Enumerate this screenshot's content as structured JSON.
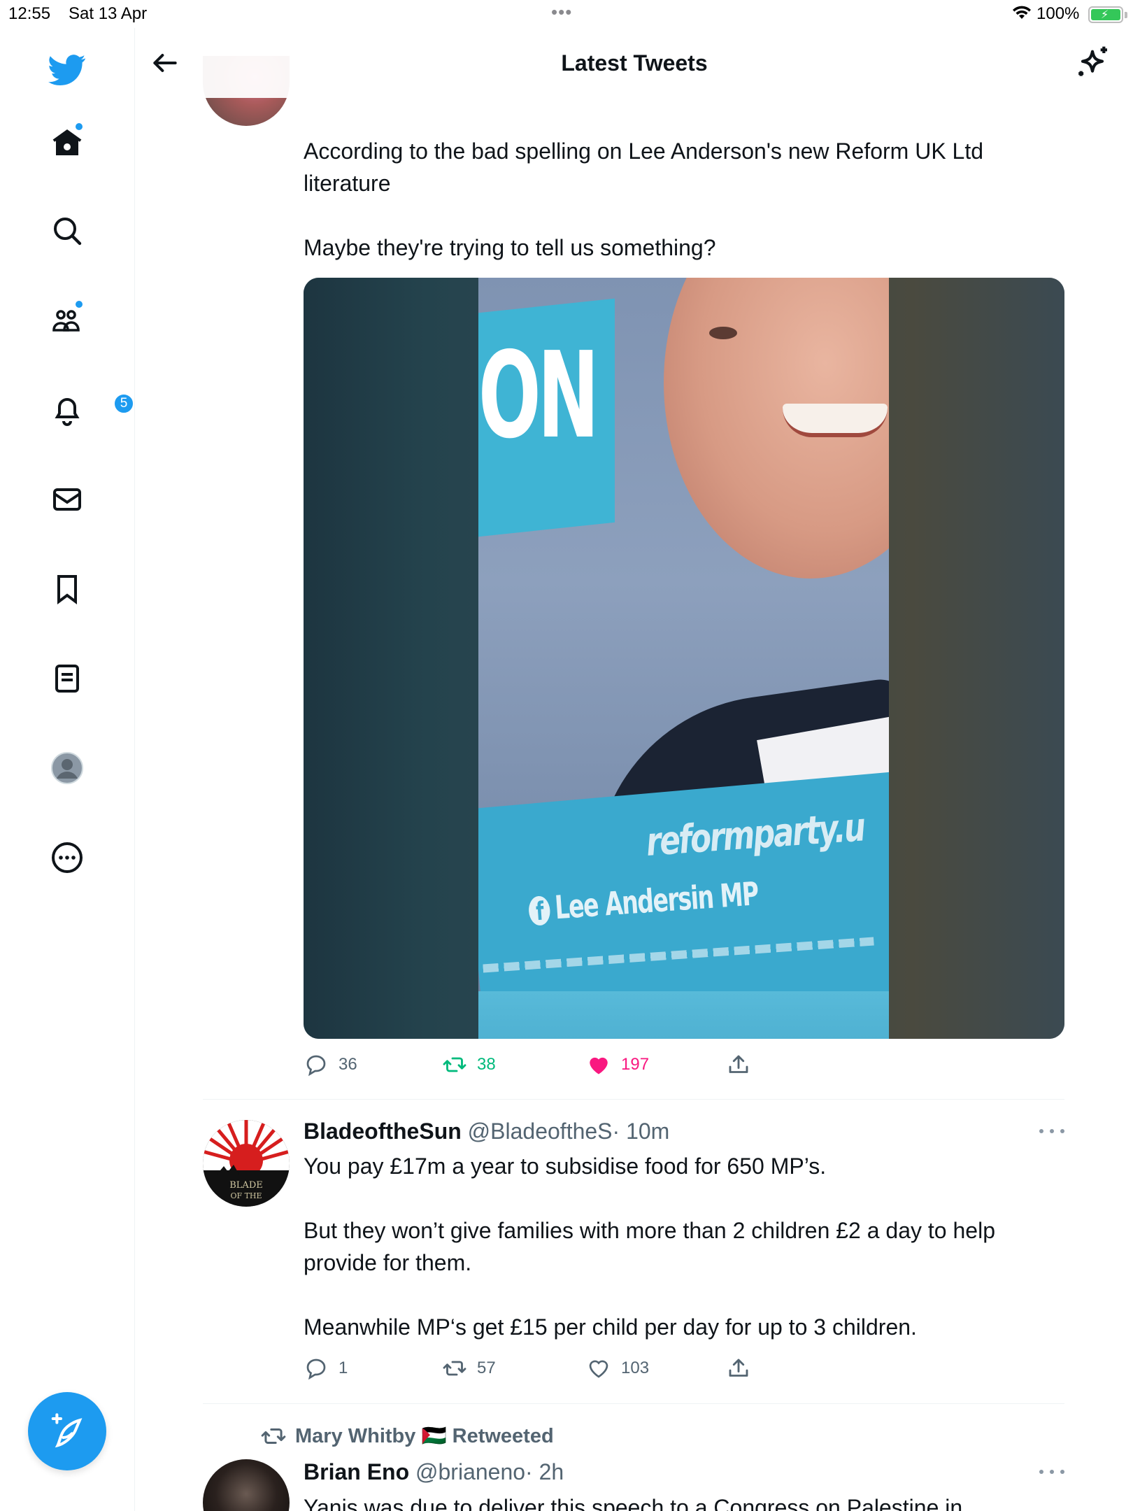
{
  "status_bar": {
    "time": "12:55",
    "date": "Sat 13 Apr",
    "battery": "100%"
  },
  "sidebar": {
    "items": [
      {
        "name": "home",
        "icon": "home-icon"
      },
      {
        "name": "search",
        "icon": "search-icon"
      },
      {
        "name": "communities",
        "icon": "communities-icon"
      },
      {
        "name": "notifications",
        "icon": "bell-icon",
        "badge": "5"
      },
      {
        "name": "messages",
        "icon": "mail-icon"
      },
      {
        "name": "bookmarks",
        "icon": "bookmark-icon"
      },
      {
        "name": "lists",
        "icon": "list-icon"
      },
      {
        "name": "profile",
        "icon": "profile-avatar-icon"
      },
      {
        "name": "more",
        "icon": "more-circle-icon"
      }
    ],
    "compose_icon": "compose-feather-icon"
  },
  "header": {
    "title": "Latest Tweets"
  },
  "tweets": [
    {
      "text": "According to the bad spelling on Lee Anderson's new Reform UK Ltd literature\n\nMaybe they're trying to tell us something?",
      "media": {
        "sign_text": "ON",
        "url_text": "reformparty.u",
        "fb_text": "Lee Andersin MP"
      },
      "replies": "36",
      "retweets": "38",
      "likes": "197",
      "liked": true,
      "retweeted": true
    },
    {
      "name": "BladeoftheSun",
      "handle": "@BladeoftheS",
      "time": "· 10m",
      "avatar_text": "BLADE OF THE SUN",
      "text": "You pay £17m a year to subsidise food for 650 MP’s.\n\nBut they won’t give families with more than 2 children £2 a day to help provide for them.\n\nMeanwhile MP‘s get £15 per child per day for up to 3 children.",
      "replies": "1",
      "retweets": "57",
      "likes": "103"
    },
    {
      "retweeted_by": "Mary Whitby 🇵🇸 Retweeted",
      "name": "Brian Eno",
      "handle": "@brianeno",
      "time": "· 2h",
      "text": "Yanis was due to deliver this speech to a Congress on Palestine in"
    }
  ],
  "colors": {
    "accent": "#1d9bf0",
    "retweet_green": "#00ba7c",
    "like_pink": "#f91880",
    "secondary_text": "#536471"
  }
}
